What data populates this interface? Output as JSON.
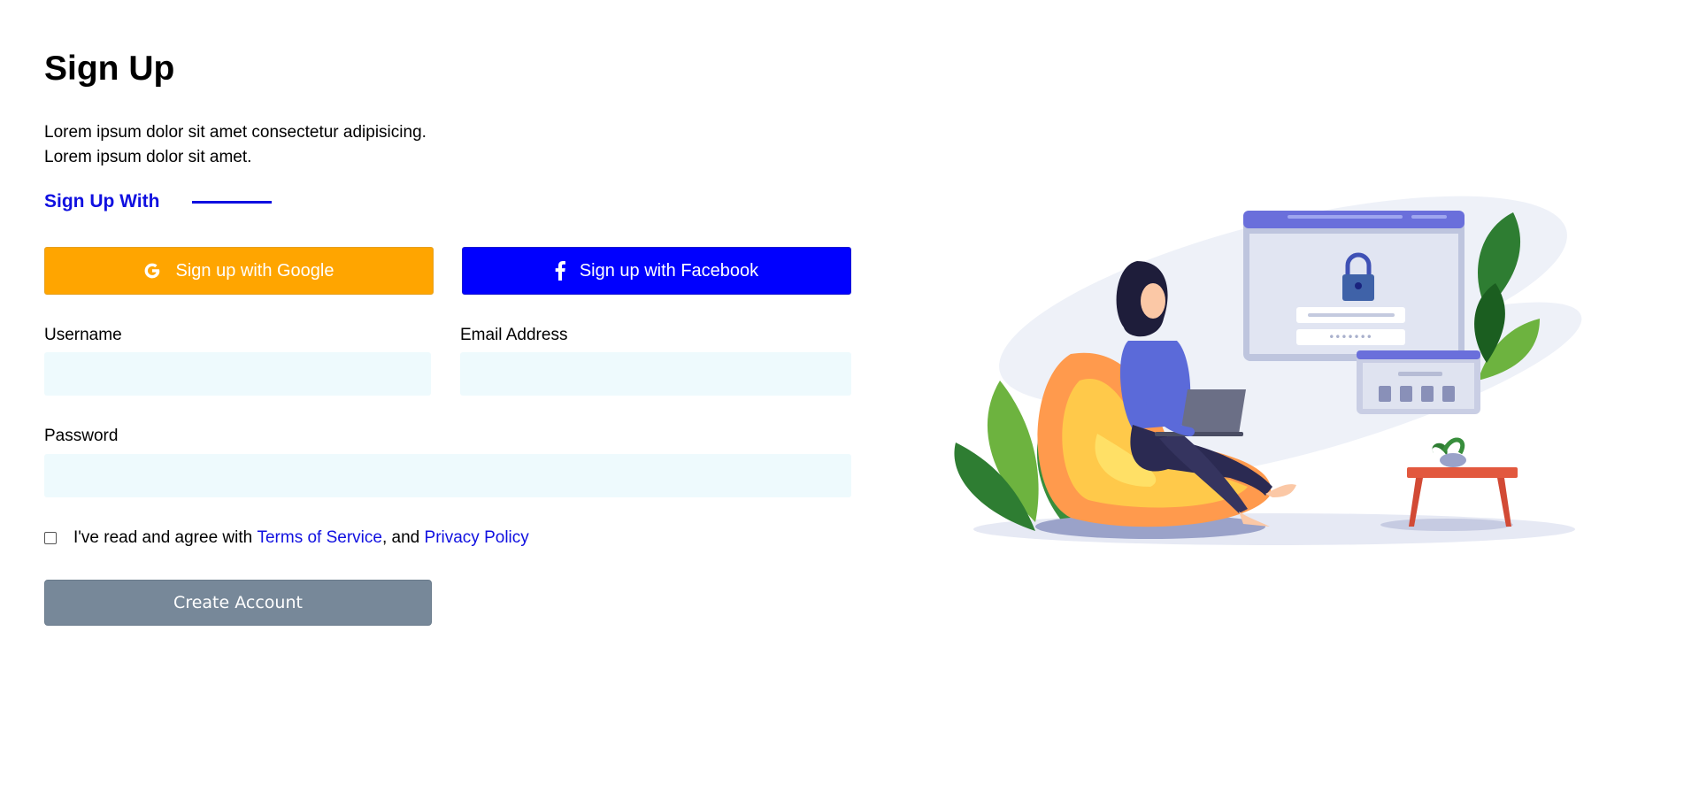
{
  "page": {
    "title": "Sign Up",
    "description": [
      "Lorem ipsum dolor sit amet consectetur adipisicing.",
      "Lorem ipsum dolor sit amet."
    ]
  },
  "social": {
    "heading": "Sign Up With",
    "google_label": "Sign up with Google",
    "facebook_label": "Sign up with Facebook",
    "google_icon": "google-icon",
    "facebook_icon": "facebook-icon"
  },
  "form": {
    "username_label": "Username",
    "username_value": "",
    "email_label": "Email Address",
    "email_value": "",
    "password_label": "Password",
    "password_value": "",
    "agree": {
      "checked": false,
      "prefix": "I've read and agree with ",
      "terms_link": "Terms of Service",
      "middle": ", and ",
      "privacy_link": "Privacy Policy"
    },
    "submit_label": "Create Account"
  },
  "colors": {
    "accent": "#1010e0",
    "google": "#ffa500",
    "facebook": "#0000ff",
    "submit": "#778899",
    "input_bg": "#eefafd"
  },
  "illustration": {
    "name": "woman-on-beanbag-with-laptop-login-illustration"
  }
}
